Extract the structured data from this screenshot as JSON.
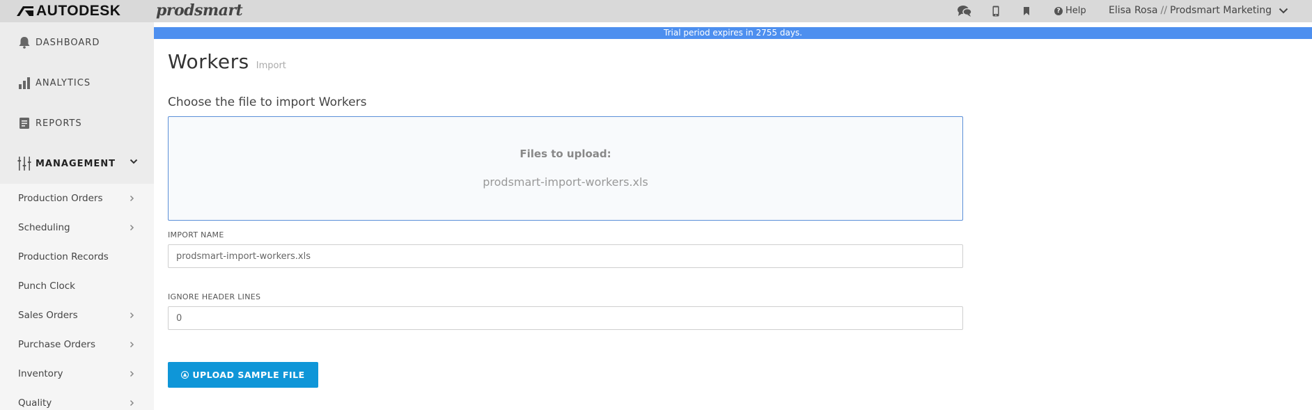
{
  "header": {
    "brand": "AUTODESK",
    "product": "prodsmart",
    "icons": [
      "chat-icon",
      "mobile-icon",
      "bookmark-icon",
      "help-icon",
      "chevron-down-icon"
    ],
    "help_label": "Help",
    "user_name": "Elisa Rosa",
    "user_separator": "//",
    "company": "Prodsmart Marketing"
  },
  "banner": {
    "text": "Trial period expires in 2755 days."
  },
  "sidebar": {
    "main_items": [
      {
        "label": "DASHBOARD",
        "icon": "bell-icon"
      },
      {
        "label": "ANALYTICS",
        "icon": "bar-chart-icon"
      },
      {
        "label": "REPORTS",
        "icon": "report-icon"
      },
      {
        "label": "MANAGEMENT",
        "icon": "sliders-icon"
      }
    ],
    "sub_items": [
      {
        "label": "Production Orders",
        "has_arrow": true
      },
      {
        "label": "Scheduling",
        "has_arrow": true
      },
      {
        "label": "Production Records",
        "has_arrow": false
      },
      {
        "label": "Punch Clock",
        "has_arrow": false
      },
      {
        "label": "Sales Orders",
        "has_arrow": true
      },
      {
        "label": "Purchase Orders",
        "has_arrow": true
      },
      {
        "label": "Inventory",
        "has_arrow": true
      },
      {
        "label": "Quality",
        "has_arrow": true
      }
    ]
  },
  "main": {
    "title": "Workers",
    "subtitle": "Import",
    "choose_text": "Choose the file to import Workers",
    "dropzone": {
      "label": "Files to upload:",
      "file": "prodsmart-import-workers.xls"
    },
    "import_name": {
      "label": "IMPORT NAME",
      "value": "prodsmart-import-workers.xls"
    },
    "ignore_header": {
      "label": "IGNORE HEADER LINES",
      "value": "0"
    },
    "upload_button": "UPLOAD SAMPLE FILE"
  },
  "colors": {
    "banner": "#4d8fef",
    "button": "#0f96d8",
    "dropzone_border": "#5b8fd8"
  }
}
